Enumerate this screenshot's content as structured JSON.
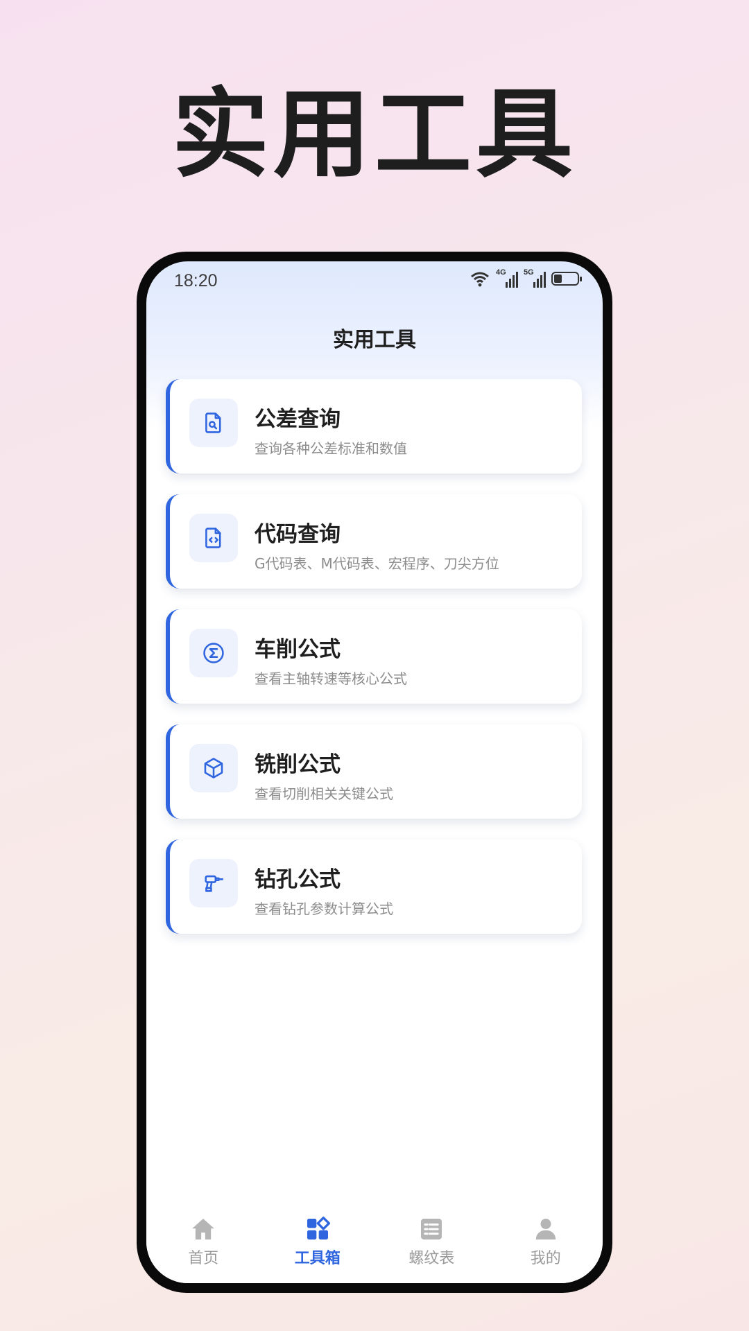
{
  "hero": {
    "title": "实用工具"
  },
  "status_bar": {
    "time": "18:20",
    "net1": "4G",
    "net2": "5G"
  },
  "page": {
    "title": "实用工具"
  },
  "tools": [
    {
      "title": "公差查询",
      "desc": "查询各种公差标准和数值",
      "icon": "document-search-icon"
    },
    {
      "title": "代码查询",
      "desc": "G代码表、M代码表、宏程序、刀尖方位",
      "icon": "code-file-icon"
    },
    {
      "title": "车削公式",
      "desc": "查看主轴转速等核心公式",
      "icon": "sigma-icon"
    },
    {
      "title": "铣削公式",
      "desc": "查看切削相关关键公式",
      "icon": "cube-icon"
    },
    {
      "title": "钻孔公式",
      "desc": "查看钻孔参数计算公式",
      "icon": "drill-icon"
    }
  ],
  "tabbar": [
    {
      "label": "首页",
      "icon": "home-icon",
      "active": false
    },
    {
      "label": "工具箱",
      "icon": "grid-icon",
      "active": true
    },
    {
      "label": "螺纹表",
      "icon": "table-icon",
      "active": false
    },
    {
      "label": "我的",
      "icon": "user-icon",
      "active": false
    }
  ],
  "colors": {
    "accent": "#2f66e0",
    "icon_bg": "#edf2fd",
    "inactive": "#b5b5b5"
  }
}
